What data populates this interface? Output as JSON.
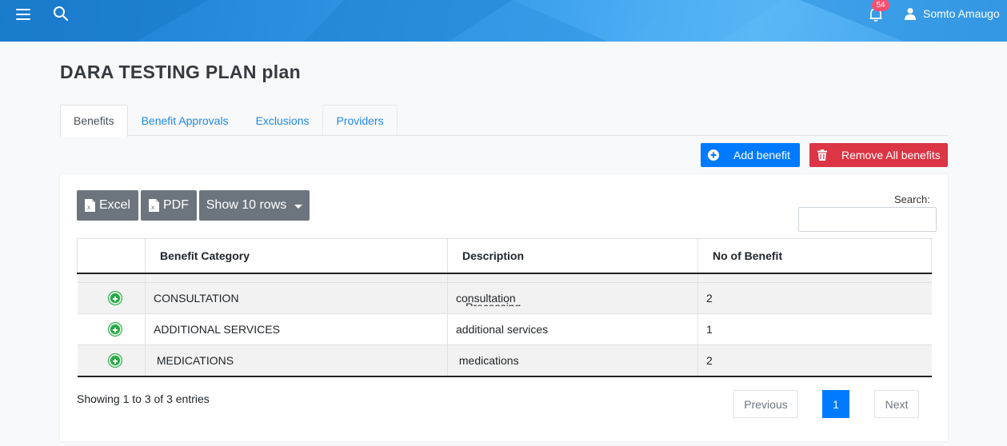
{
  "header": {
    "notification_count": "54",
    "user_name": "Somto Amaugo"
  },
  "page": {
    "title": "DARA TESTING PLAN plan"
  },
  "tabs": [
    {
      "label": "Benefits",
      "active": true
    },
    {
      "label": "Benefit Approvals",
      "active": false
    },
    {
      "label": "Exclusions",
      "active": false
    },
    {
      "label": "Providers",
      "active": false
    }
  ],
  "actions": {
    "add_label": "Add benefit",
    "remove_label": "Remove All benefits"
  },
  "table_tools": {
    "excel_label": "Excel",
    "pdf_label": "PDF",
    "rows_label": "Show 10 rows",
    "search_label": "Search:",
    "search_value": ""
  },
  "table": {
    "columns": [
      "",
      "Benefit Category",
      "Description",
      "No of Benefit"
    ],
    "rows": [
      {
        "category": "CONSULTATION",
        "description": "consultation",
        "description_overflow": "Processing",
        "count": "2"
      },
      {
        "category": "ADDITIONAL SERVICES",
        "description": "additional services",
        "count": "1"
      },
      {
        "category": " MEDICATIONS",
        "description": " medications",
        "count": "2"
      }
    ]
  },
  "footer": {
    "info": "Showing 1 to 3 of 3 entries",
    "previous_label": "Previous",
    "current_page": "1",
    "next_label": "Next"
  },
  "colors": {
    "primary": "#007bff",
    "danger": "#dc3545",
    "secondary": "#6c757d",
    "success": "#28a745",
    "badge": "#ff4d6d"
  }
}
